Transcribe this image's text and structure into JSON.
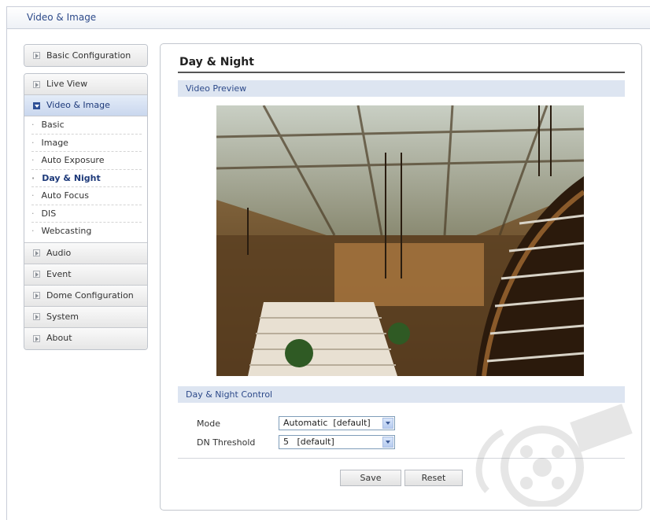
{
  "header": {
    "title": "Video & Image"
  },
  "sidebar": {
    "top_item": "Basic Configuration",
    "items": [
      {
        "label": "Live View"
      },
      {
        "label": "Video & Image",
        "active": true
      }
    ],
    "sub_items": [
      {
        "label": "Basic"
      },
      {
        "label": "Image"
      },
      {
        "label": "Auto Exposure"
      },
      {
        "label": "Day & Night",
        "selected": true
      },
      {
        "label": "Auto Focus"
      },
      {
        "label": "DIS"
      },
      {
        "label": "Webcasting"
      }
    ],
    "lower_items": [
      {
        "label": "Audio"
      },
      {
        "label": "Event"
      },
      {
        "label": "Dome Configuration"
      },
      {
        "label": "System"
      },
      {
        "label": "About"
      }
    ]
  },
  "main": {
    "title": "Day & Night",
    "preview_section": "Video Preview",
    "control_section": "Day & Night Control",
    "mode": {
      "label": "Mode",
      "value": "Automatic  [default]"
    },
    "threshold": {
      "label": "DN Threshold",
      "value": "5   [default]"
    },
    "buttons": {
      "save": "Save",
      "reset": "Reset"
    }
  },
  "colors": {
    "accent": "#2d4a8a",
    "section_bg": "#dde5f1",
    "active_nav": "#c9d7ee"
  },
  "icons": {
    "nav_arrow": "triangle-right",
    "dropdown": "triangle-down",
    "watermark": "film-reel"
  }
}
